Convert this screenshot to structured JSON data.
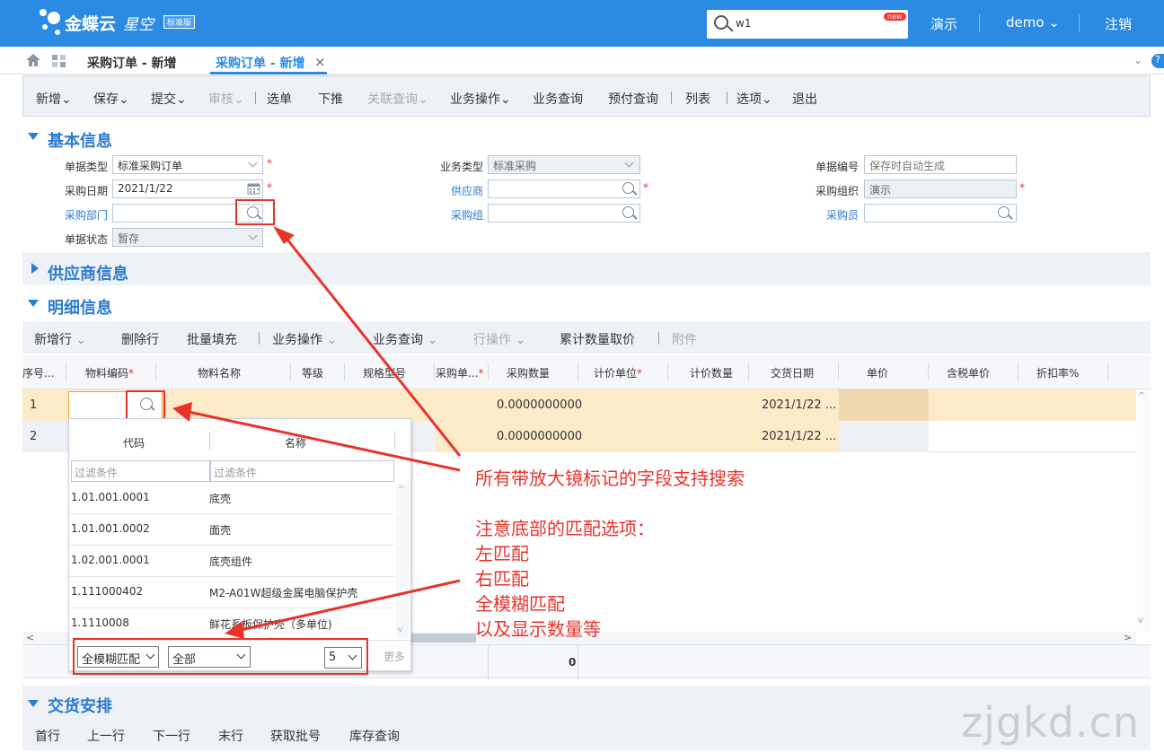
{
  "app": {
    "brand": "金蝶云",
    "brand_sub": "星空",
    "edition": "标准版"
  },
  "search": {
    "value": "w1",
    "badge": "new"
  },
  "topnav": {
    "item1": "演示",
    "user": "demo",
    "logout": "注销"
  },
  "tabs": {
    "tab1": "采购订单 - 新增",
    "tab2": "采购订单 - 新增",
    "close": "×"
  },
  "toolbar": {
    "items": [
      "新增",
      "保存",
      "提交",
      "审核",
      "选单",
      "下推",
      "关联查询",
      "业务操作",
      "业务查询",
      "预付查询",
      "列表",
      "选项",
      "退出"
    ]
  },
  "basic": {
    "title": "基本信息",
    "doc_type_label": "单据类型",
    "doc_type": "标准采购订单",
    "biz_type_label": "业务类型",
    "biz_type": "标准采购",
    "doc_no_label": "单据编号",
    "doc_no_placeholder": "保存时自动生成",
    "purchase_date_label": "采购日期",
    "purchase_date": "2021/1/22",
    "supplier_label": "供应商",
    "purchase_org_label": "采购组织",
    "purchase_org": "演示",
    "dept_label": "采购部门",
    "group_label": "采购组",
    "buyer_label": "采购员",
    "status_label": "单据状态",
    "status": "暂存",
    "req": "*"
  },
  "supplier_section": {
    "title": "供应商信息"
  },
  "detail": {
    "title": "明细信息",
    "toolbar": [
      "新增行",
      "删除行",
      "批量填充",
      "业务操作",
      "业务查询",
      "行操作",
      "累计数量取价",
      "附件"
    ],
    "columns": [
      "序号...",
      "物料编码",
      "物料名称",
      "等级",
      "规格型号",
      "采购单...",
      "采购数量",
      "计价单位",
      "计价数量",
      "交货日期",
      "单价",
      "含税单价",
      "折扣率%"
    ],
    "rows": [
      {
        "seq": "1",
        "qty": "0.0000000000",
        "date": "2021/1/22 ..."
      },
      {
        "seq": "2",
        "qty": "0.0000000000",
        "date": "2021/1/22 ..."
      }
    ],
    "total": "0"
  },
  "lookup": {
    "col_code": "代码",
    "col_name": "名称",
    "filter_placeholder": "过滤条件",
    "items": [
      {
        "code": "1.01.001.0001",
        "name": "底壳"
      },
      {
        "code": "1.01.001.0002",
        "name": "面壳"
      },
      {
        "code": "1.02.001.0001",
        "name": "底壳组件"
      },
      {
        "code": "1.111000402",
        "name": "M2-A01W超级金属电脑保护壳"
      },
      {
        "code": "1.1110008",
        "name": "鲜花系板保护壳（多单位)"
      }
    ],
    "match_mode": "全模糊匹配",
    "scope": "全部",
    "count": "5",
    "more": "更多"
  },
  "delivery": {
    "title": "交货安排",
    "toolbar": [
      "首行",
      "上一行",
      "下一行",
      "末行",
      "获取批号",
      "库存查询"
    ]
  },
  "annotations": {
    "a1": "所有带放大镜标记的字段支持搜索",
    "a2": "注意底部的匹配选项：",
    "a3": "左匹配",
    "a4": "右匹配",
    "a5": "全模糊匹配",
    "a6": "以及显示数量等"
  },
  "watermark": "zjgkd.cn",
  "colors": {
    "primary": "#2b8ae3",
    "annotation": "#e8332b",
    "selected_row": "#fcebc9"
  }
}
